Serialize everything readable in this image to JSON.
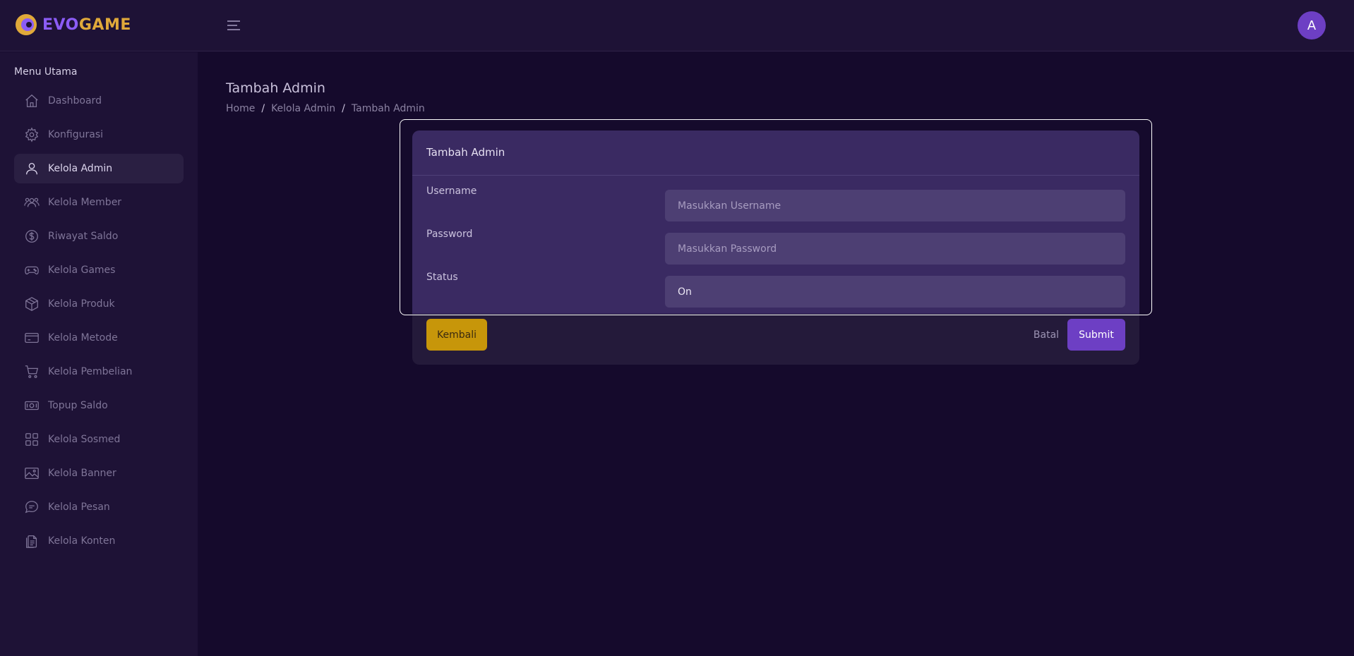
{
  "brand": {
    "name_part1": "EVO",
    "name_part2": "GAME",
    "accent": "#8b5cf6",
    "secondary": "#e0a93a"
  },
  "header": {
    "avatar_initial": "A",
    "menu_icon": "hamburger-icon"
  },
  "sidebar": {
    "title": "Menu Utama",
    "items": [
      {
        "label": "Dashboard",
        "icon": "home-icon",
        "active": false
      },
      {
        "label": "Konfigurasi",
        "icon": "gear-icon",
        "active": false
      },
      {
        "label": "Kelola Admin",
        "icon": "user-icon",
        "active": true
      },
      {
        "label": "Kelola Member",
        "icon": "users-icon",
        "active": false
      },
      {
        "label": "Riwayat Saldo",
        "icon": "dollar-icon",
        "active": false
      },
      {
        "label": "Kelola Games",
        "icon": "gamepad-icon",
        "active": false
      },
      {
        "label": "Kelola Produk",
        "icon": "box-icon",
        "active": false
      },
      {
        "label": "Kelola Metode",
        "icon": "card-icon",
        "active": false
      },
      {
        "label": "Kelola Pembelian",
        "icon": "cart-icon",
        "active": false
      },
      {
        "label": "Topup Saldo",
        "icon": "money-icon",
        "active": false
      },
      {
        "label": "Kelola Sosmed",
        "icon": "grid-icon",
        "active": false
      },
      {
        "label": "Kelola Banner",
        "icon": "image-icon",
        "active": false
      },
      {
        "label": "Kelola Pesan",
        "icon": "chat-icon",
        "active": false
      },
      {
        "label": "Kelola Konten",
        "icon": "document-icon",
        "active": false
      }
    ]
  },
  "page": {
    "title": "Tambah Admin",
    "breadcrumb": [
      "Home",
      "Kelola Admin",
      "Tambah Admin"
    ]
  },
  "form": {
    "title": "Tambah Admin",
    "username": {
      "label": "Username",
      "placeholder": "Masukkan Username",
      "value": ""
    },
    "password": {
      "label": "Password",
      "placeholder": "Masukkan Password",
      "value": ""
    },
    "status": {
      "label": "Status",
      "value": "On"
    },
    "buttons": {
      "back": "Kembali",
      "cancel": "Batal",
      "submit": "Submit"
    }
  }
}
